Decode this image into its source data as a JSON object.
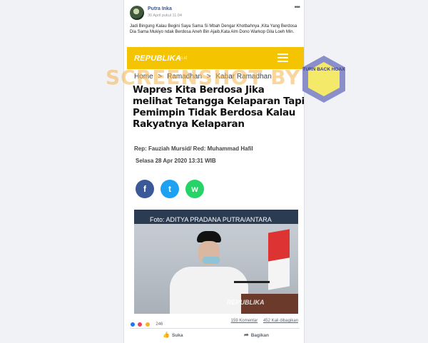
{
  "post": {
    "author": "Putra Inka",
    "timestamp": "30 April pukul 11.04",
    "text": "Jadi Bingung Kalau Begini Saya Sama Si Mbah Dengar Khotbahnya ,Kita Yang Berdosa Dia Sama Mukiyo ndak Berdosa Aneh Bin Ajaib,Kata Alm Dono Warkop Gila Loeh Min.",
    "more_icon": "more-dots-icon"
  },
  "screenshot": {
    "brand": "REPUBLIKA",
    "brand_sub": ".co.id",
    "breadcrumb": [
      "Home",
      "Ramadhan",
      "Kabar Ramadhan"
    ],
    "breadcrumb_sep": ">",
    "headline": "Wapres Kita Berdosa Jika melihat Tetangga Kelaparan Tapi Pemimpin Tidak Berdosa Kalau Rakyatnya Kelaparan",
    "byline": "Rep: Fauziah Mursid/ Red: Muhammad Hafil",
    "date": "Selasa 28 Apr 2020 13:31 WIB",
    "photo_credit": "Foto: ADITYA PRADANA PUTRA/ANTARA",
    "photo_watermark": "REPUBLIKA",
    "share_icons": {
      "facebook": "f",
      "twitter": "t",
      "whatsapp": "w"
    }
  },
  "overlay": {
    "watermark": "SCREENSHOT BY",
    "seal_text": "TURN BACK HOAX",
    "seal_colors": {
      "outer": "#8a8fc9",
      "inner": "#f5e96a"
    }
  },
  "footer": {
    "reaction_count": "246",
    "comments": "159 Komentar",
    "shares": "452 Kali dibagikan",
    "like_label": "Suka",
    "share_label": "Bagikan"
  },
  "colors": {
    "republika_bar": "#f5c400",
    "link": "#385898"
  }
}
